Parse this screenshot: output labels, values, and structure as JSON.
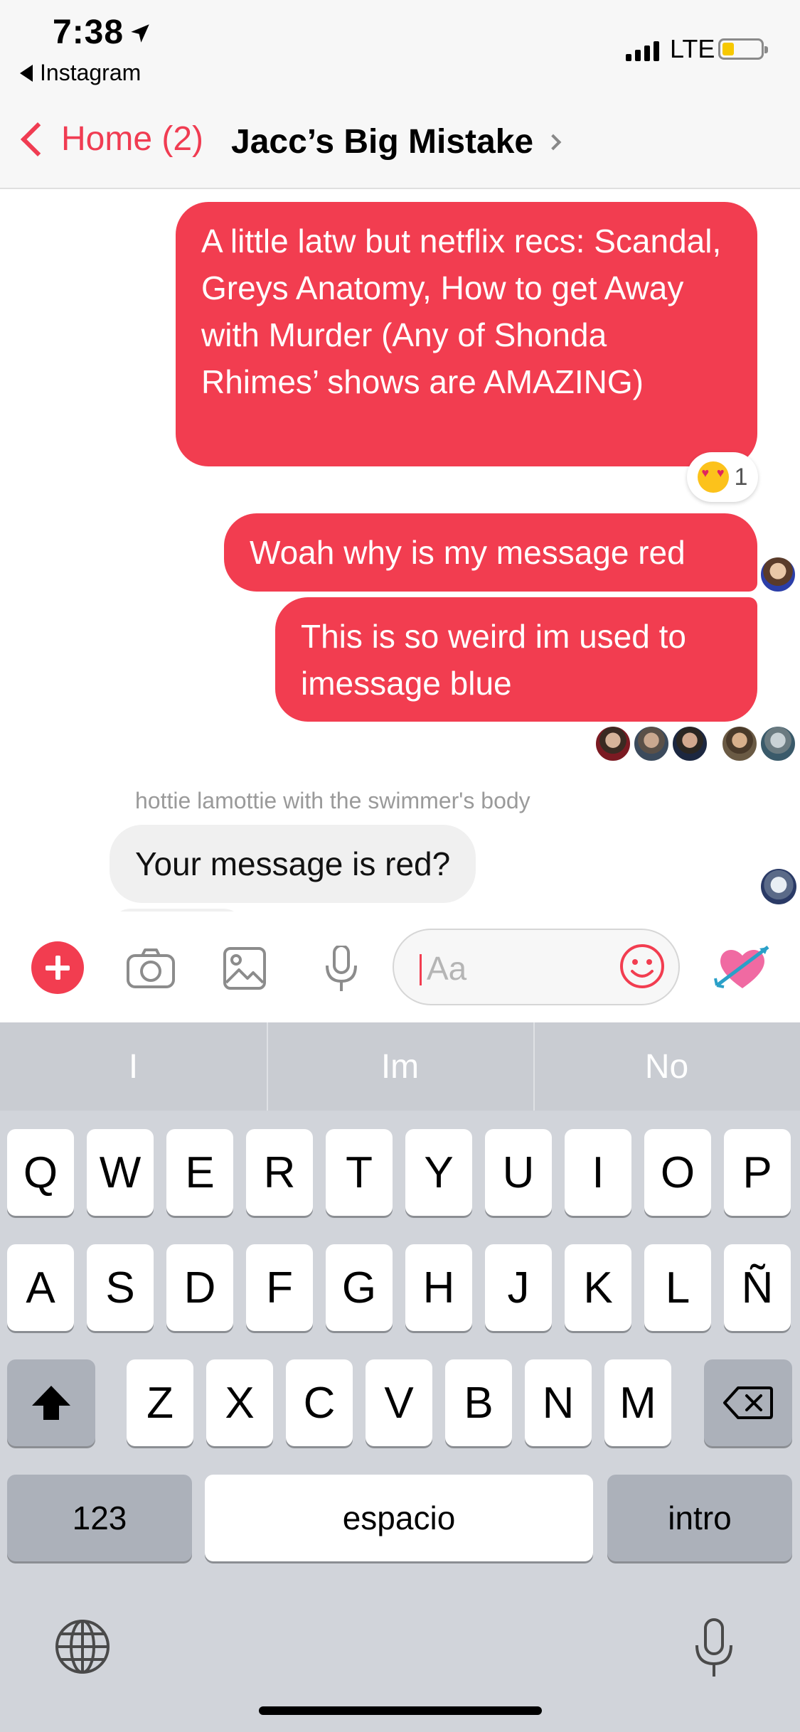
{
  "status_bar": {
    "time": "7:38",
    "back_app": "Instagram",
    "network": "LTE",
    "battery_level": 0.3
  },
  "header": {
    "back_label": "Home (2)",
    "title": "Jacc’s Big Mistake"
  },
  "messages": [
    {
      "from": "me",
      "text": "A little latw but netflix recs: Scandal, Greys Anatomy, How to get Away with Murder (Any of Shonda Rhimes’ shows are AMAZING)",
      "reaction": {
        "emoji": "heart-eyes-emoji",
        "count": "1"
      }
    },
    {
      "from": "me",
      "text": "Woah why is my message red"
    },
    {
      "from": "me",
      "text": "This is so weird im used to imessage blue"
    },
    {
      "from": "other",
      "sender": "hottie lamottie with the swimmer's body",
      "text": "Your message is red?"
    }
  ],
  "composer": {
    "placeholder": "Aa",
    "icons": [
      "plus-icon",
      "camera-icon",
      "photo-icon",
      "microphone-icon",
      "emoji-icon",
      "heart-arrow-icon"
    ]
  },
  "keyboard": {
    "suggestions": [
      "I",
      "Im",
      "No"
    ],
    "row1": [
      "Q",
      "W",
      "E",
      "R",
      "T",
      "Y",
      "U",
      "I",
      "O",
      "P"
    ],
    "row2": [
      "A",
      "S",
      "D",
      "F",
      "G",
      "H",
      "J",
      "K",
      "L",
      "Ñ"
    ],
    "row3": [
      "Z",
      "X",
      "C",
      "V",
      "B",
      "N",
      "M"
    ],
    "numbers_label": "123",
    "space_label": "espacio",
    "return_label": "intro"
  },
  "colors": {
    "accent": "#f23d50",
    "keyboard_bg": "#d1d4da"
  }
}
